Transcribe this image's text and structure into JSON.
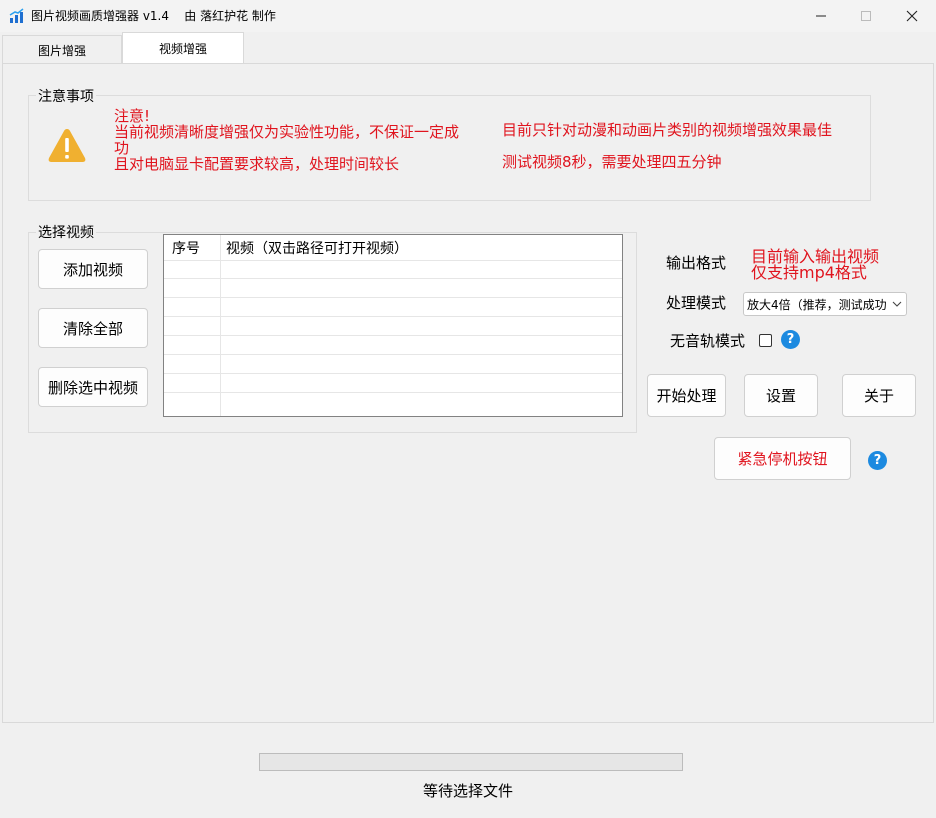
{
  "window": {
    "title": "图片视频画质增强器 v1.4    由 落红护花 制作",
    "icon": "app-chart-icon"
  },
  "tabs": [
    {
      "label": "图片增强",
      "active": false
    },
    {
      "label": "视频增强",
      "active": true
    }
  ],
  "notice": {
    "group_label": "注意事项",
    "icon": "warning-icon",
    "left_lines": [
      "注意!",
      "当前视频清晰度增强仅为实验性功能，不保证一定成",
      "功",
      "且对电脑显卡配置要求较高，处理时间较长"
    ],
    "right_lines": [
      "目前只针对动漫和动画片类别的视频增强效果最佳",
      "测试视频8秒，需要处理四五分钟"
    ]
  },
  "video_select": {
    "group_label": "选择视频",
    "add_button": "添加视频",
    "clear_button": "清除全部",
    "delete_button": "删除选中视频",
    "list": {
      "columns": [
        "序号",
        "视频（双击路径可打开视频）"
      ],
      "rows": []
    }
  },
  "settings": {
    "output_format_label": "输出格式",
    "output_format_note_1": "目前输入输出视频",
    "output_format_note_2": "仅支持mp4格式",
    "mode_label": "处理模式",
    "mode_selected": "放大4倍（推荐，测试成功",
    "no_audio_label": "无音轨模式",
    "no_audio_checked": false,
    "help_icon": "?",
    "start_button": "开始处理",
    "settings_button": "设置",
    "about_button": "关于",
    "emergency_button": "紧急停机按钮"
  },
  "footer": {
    "progress": 0,
    "status": "等待选择文件"
  },
  "colors": {
    "warning_text": "#e0141e",
    "help_blue": "#1c8ae0",
    "warning_icon": "#f0b030"
  }
}
